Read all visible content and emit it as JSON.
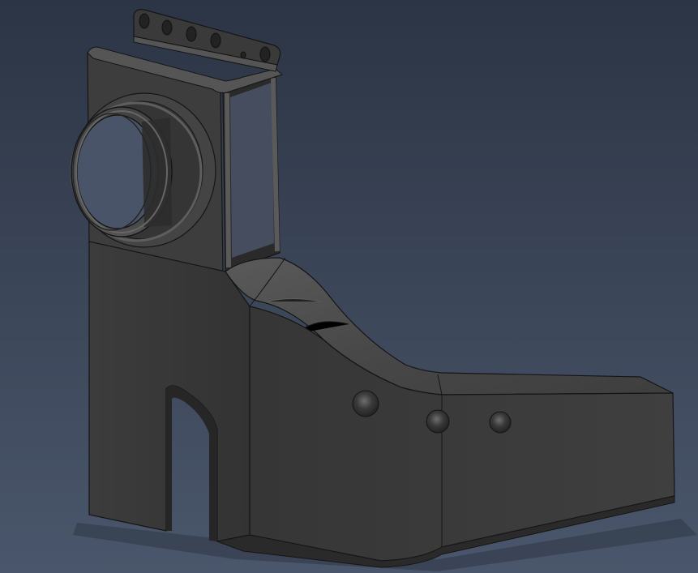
{
  "scene": {
    "subject": "cad-3d-part-render",
    "background": {
      "top": "#2c3545",
      "bottom": "#4a566b"
    },
    "part_colors": {
      "dark": "#2e2e2e",
      "mid": "#3a3a3a",
      "light": "#4a4a4a",
      "highlight": "#6a6a6a",
      "edge": "#151515"
    }
  }
}
